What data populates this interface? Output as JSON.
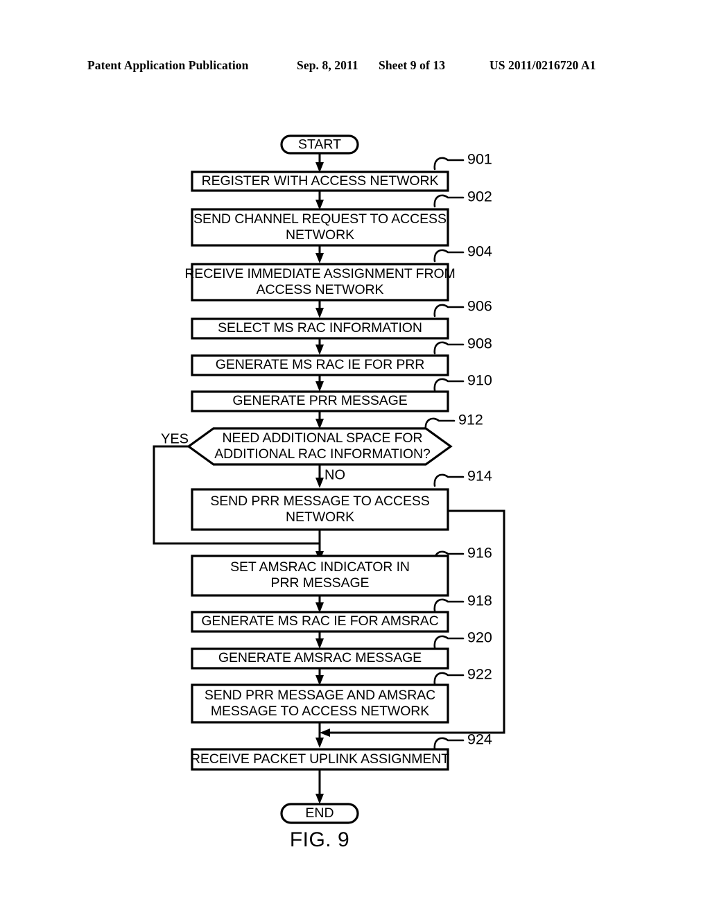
{
  "header": {
    "publication": "Patent Application Publication",
    "date": "Sep. 8, 2011",
    "sheet": "Sheet 9 of 13",
    "patent_number": "US 2011/0216720 A1"
  },
  "figure": {
    "caption": "FIG. 9",
    "start_label": "START",
    "end_label": "END",
    "branch_yes": "YES",
    "branch_no": "NO",
    "steps": [
      {
        "ref": "901",
        "text_line1": "REGISTER WITH ACCESS NETWORK",
        "text_line2": ""
      },
      {
        "ref": "902",
        "text_line1": "SEND CHANNEL REQUEST TO ACCESS",
        "text_line2": "NETWORK"
      },
      {
        "ref": "904",
        "text_line1": "RECEIVE IMMEDIATE ASSIGNMENT FROM",
        "text_line2": "ACCESS NETWORK"
      },
      {
        "ref": "906",
        "text_line1": "SELECT MS RAC INFORMATION",
        "text_line2": ""
      },
      {
        "ref": "908",
        "text_line1": "GENERATE MS RAC IE FOR PRR",
        "text_line2": ""
      },
      {
        "ref": "910",
        "text_line1": "GENERATE PRR MESSAGE",
        "text_line2": ""
      },
      {
        "ref": "912",
        "text_line1": "NEED ADDITIONAL SPACE FOR",
        "text_line2": "ADDITIONAL RAC INFORMATION?"
      },
      {
        "ref": "914",
        "text_line1": "SEND PRR MESSAGE TO ACCESS",
        "text_line2": "NETWORK"
      },
      {
        "ref": "916",
        "text_line1": "SET AMSRAC INDICATOR IN",
        "text_line2": "PRR MESSAGE"
      },
      {
        "ref": "918",
        "text_line1": "GENERATE MS RAC IE FOR AMSRAC",
        "text_line2": ""
      },
      {
        "ref": "920",
        "text_line1": "GENERATE AMSRAC MESSAGE",
        "text_line2": ""
      },
      {
        "ref": "922",
        "text_line1": "SEND PRR MESSAGE AND AMSRAC",
        "text_line2": "MESSAGE TO ACCESS NETWORK"
      },
      {
        "ref": "924",
        "text_line1": "RECEIVE PACKET UPLINK ASSIGNMENT",
        "text_line2": ""
      }
    ]
  },
  "colors": {
    "ink": "#000000",
    "paper": "#ffffff"
  }
}
